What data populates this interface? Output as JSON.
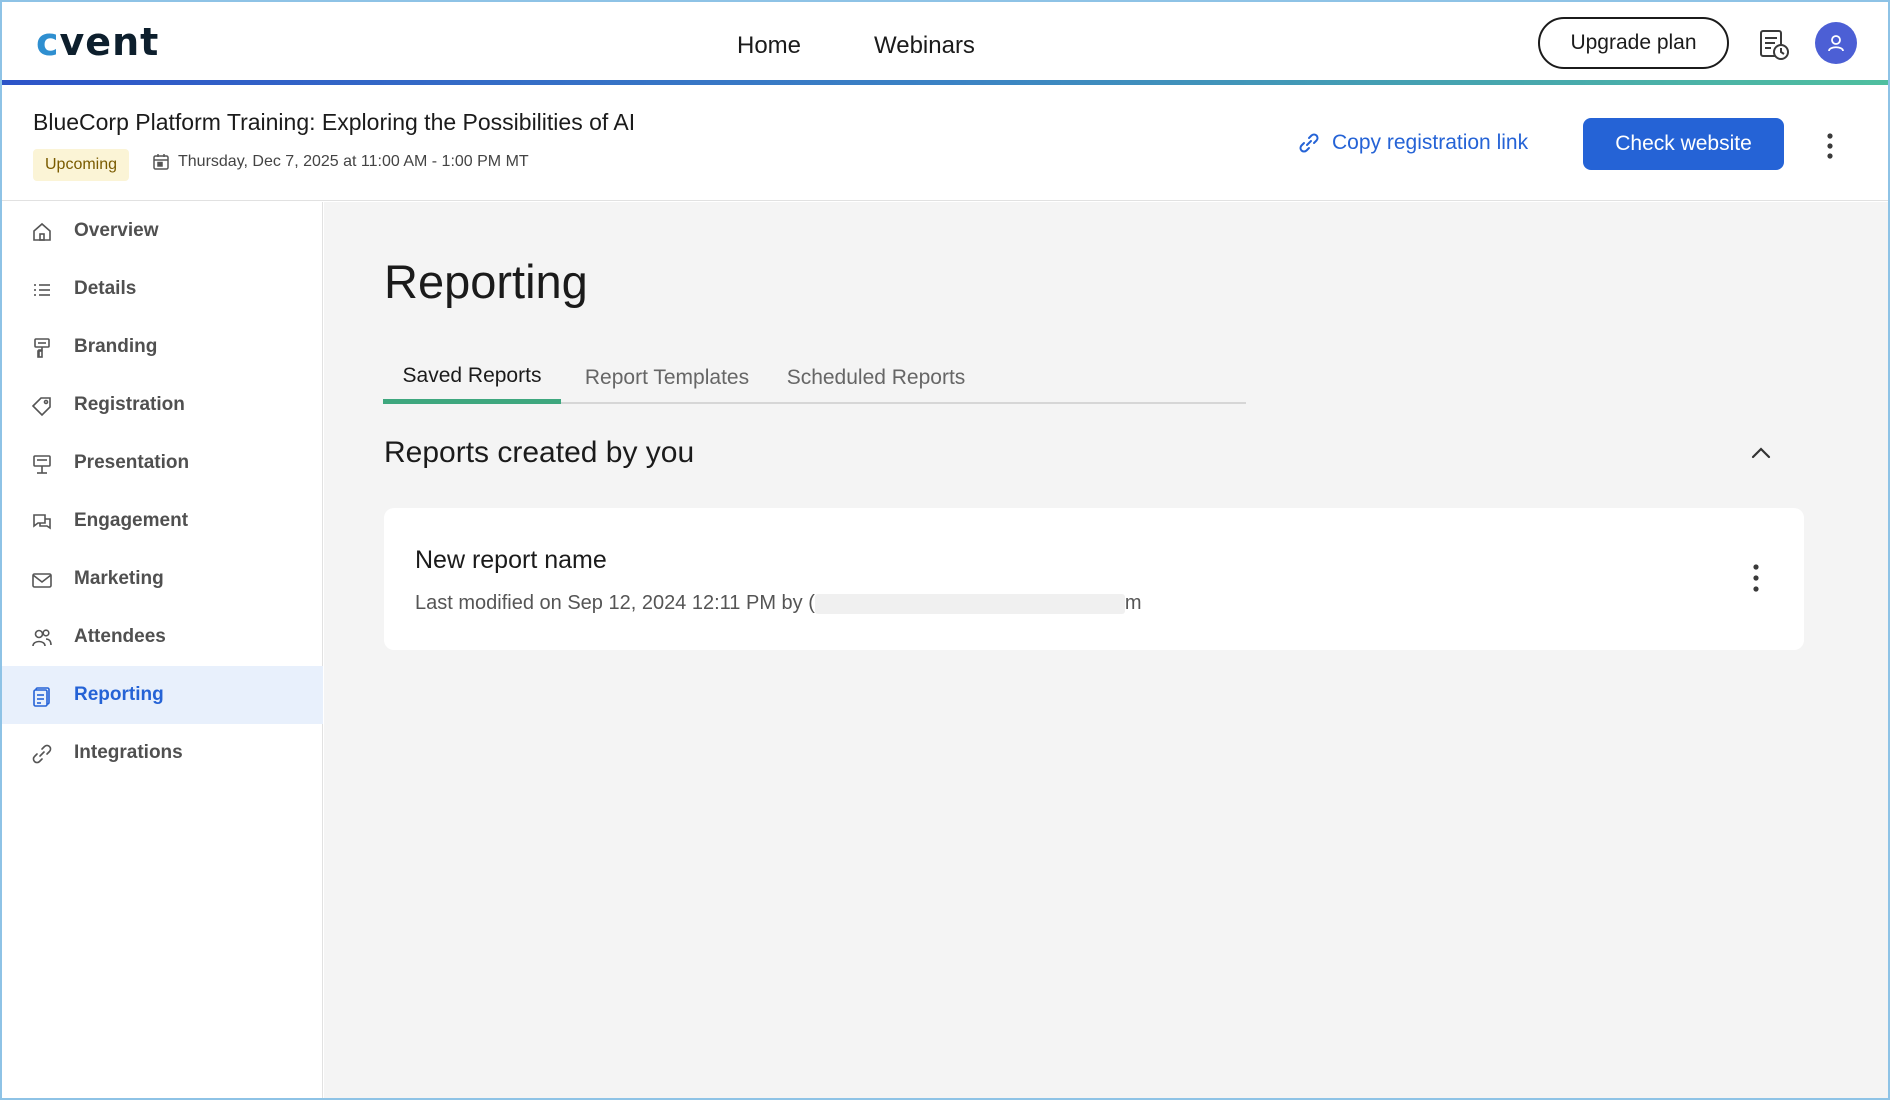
{
  "app": {
    "logo": {
      "prefix": "c",
      "rest": "vent"
    },
    "nav": {
      "home": "Home",
      "webinars": "Webinars"
    },
    "upgrade_label": "Upgrade plan",
    "icons": {
      "calendar_clock": "calendar-clock-icon",
      "avatar": "user-icon"
    },
    "colors": {
      "primary": "#2563d6",
      "avatar": "#4c5fd5",
      "tab_active": "#3ea77e",
      "badge_bg": "#fbf4d6"
    }
  },
  "event": {
    "title": "BlueCorp Platform Training: Exploring the Possibilities of AI",
    "status": "Upcoming",
    "date": "Thursday, Dec 7, 2025 at 11:00 AM - 1:00 PM MT",
    "copy_link_label": "Copy registration link",
    "check_website_label": "Check website"
  },
  "sidebar": {
    "items": [
      {
        "label": "Overview",
        "icon": "home-icon"
      },
      {
        "label": "Details",
        "icon": "list-icon"
      },
      {
        "label": "Branding",
        "icon": "paint-roller-icon"
      },
      {
        "label": "Registration",
        "icon": "tag-icon"
      },
      {
        "label": "Presentation",
        "icon": "presentation-icon"
      },
      {
        "label": "Engagement",
        "icon": "chat-icon"
      },
      {
        "label": "Marketing",
        "icon": "mail-icon"
      },
      {
        "label": "Attendees",
        "icon": "people-icon"
      },
      {
        "label": "Reporting",
        "icon": "report-icon",
        "active": true
      },
      {
        "label": "Integrations",
        "icon": "link-icon"
      }
    ]
  },
  "main": {
    "title": "Reporting",
    "tabs": [
      "Saved Reports",
      "Report Templates",
      "Scheduled Reports"
    ],
    "active_tab": "Saved Reports",
    "section_title": "Reports created by you",
    "reports": [
      {
        "name": "New report name",
        "meta_prefix": "Last modified on Sep 12, 2024 12:11 PM by (",
        "meta_suffix": "m"
      }
    ]
  }
}
